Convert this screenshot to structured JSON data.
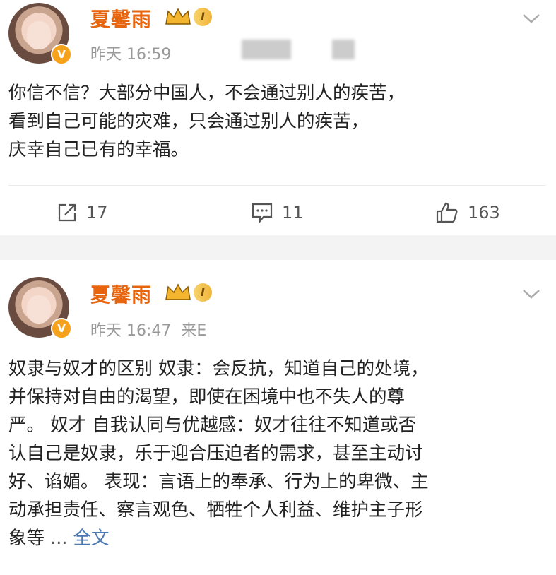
{
  "posts": [
    {
      "username": "夏馨雨",
      "level": "I",
      "time": "昨天 16:59",
      "source": "",
      "text_lines": [
        "你信不信？大部分中国人，不会通过别人的疾苦，",
        "看到自己可能的灾难，只会通过别人的疾苦，",
        "庆幸自己已有的幸福。"
      ],
      "actions": {
        "repost": "17",
        "comments": "11",
        "likes": "163"
      }
    },
    {
      "username": "夏馨雨",
      "level": "I",
      "time": "昨天 16:47",
      "source": "来E",
      "text_lines": [
        "奴隶与奴才的区别 奴隶：会反抗，知道自己的处境，",
        "并保持对自由的渴望，即使在困境中也不失人的尊",
        "严。 奴才 自我认同与优越感：奴才往往不知道或否",
        "认自己是奴隶，乐于迎合压迫者的需求，甚至主动讨",
        "好、谄媚。 表现：言语上的奉承、行为上的卑微、主",
        "动承担责任、察言观色、牺牲个人利益、维护主子形"
      ],
      "last_line": "象等",
      "ellipsis": " ... ",
      "full_text_link": "全文"
    }
  ],
  "icons": {
    "verified": "V",
    "repost": "repost-icon",
    "comment": "comment-icon",
    "like": "like-icon",
    "chevron": "chevron-down-icon"
  },
  "colors": {
    "username": "#e8650f",
    "link": "#4a79b4",
    "meta": "#999999",
    "badge": "#f6a21c"
  }
}
